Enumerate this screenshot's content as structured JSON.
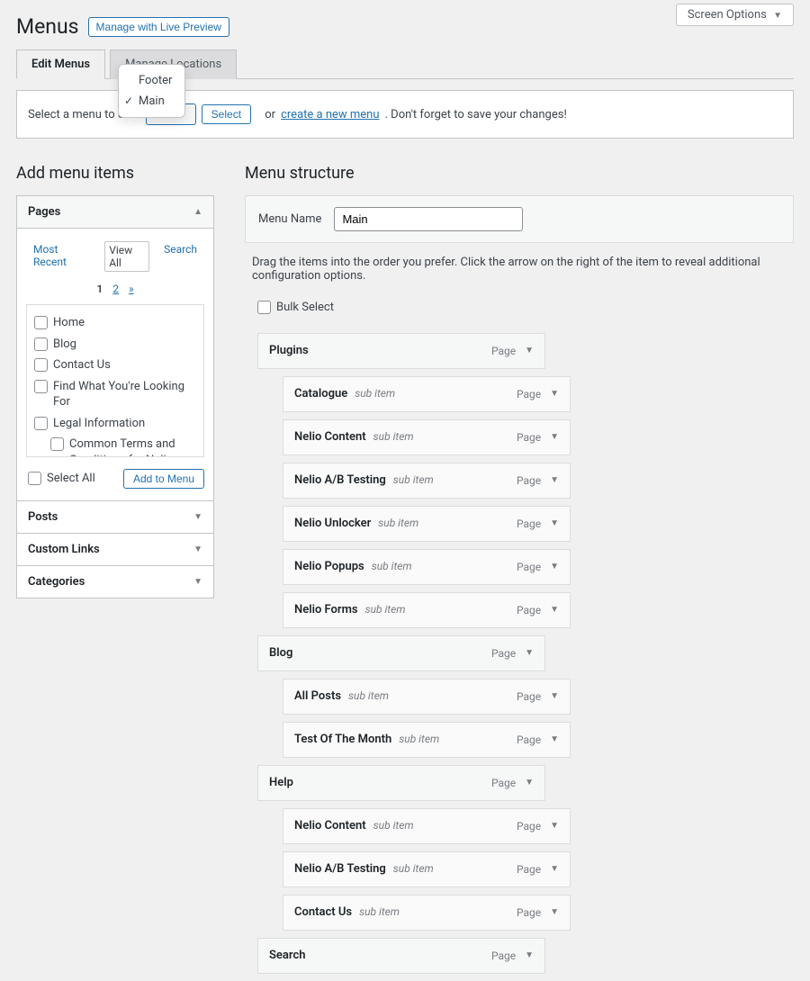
{
  "screen_options": "Screen Options",
  "page_title": "Menus",
  "live_preview": "Manage with Live Preview",
  "tabs": {
    "edit": "Edit Menus",
    "locations": "Manage Locations"
  },
  "select_menu_label": "Select a menu to edit:",
  "select_btn": "Select",
  "or_text": "or",
  "create_menu_link": "create a new menu",
  "save_reminder": ". Don't forget to save your changes!",
  "dropdown": {
    "footer": "Footer",
    "main": "Main"
  },
  "add_items_heading": "Add menu items",
  "menu_structure_heading": "Menu structure",
  "pages_box": {
    "title": "Pages",
    "subtabs": {
      "recent": "Most Recent",
      "all": "View All",
      "search": "Search"
    },
    "pager": {
      "p1": "1",
      "p2": "2",
      "next": "»"
    },
    "items": {
      "home": "Home",
      "blog": "Blog",
      "contact": "Contact Us",
      "find": "Find What You're Looking For",
      "legal": "Legal Information",
      "terms": "Common Terms and Conditions for Nelio Services"
    },
    "select_all": "Select All",
    "add_to_menu": "Add to Menu"
  },
  "posts_box": "Posts",
  "links_box": "Custom Links",
  "cats_box": "Categories",
  "menu_name_label": "Menu Name",
  "menu_name_value": "Main",
  "drag_note": "Drag the items into the order you prefer. Click the arrow on the right of the item to reveal additional configuration options.",
  "bulk_select": "Bulk Select",
  "type_label": "Page",
  "sub_item_label": "sub item",
  "items": {
    "plugins": "Plugins",
    "catalogue": "Catalogue",
    "ncontent": "Nelio Content",
    "nab": "Nelio A/B Testing",
    "nunlock": "Nelio Unlocker",
    "npopups": "Nelio Popups",
    "nforms": "Nelio Forms",
    "blog": "Blog",
    "allposts": "All Posts",
    "totm": "Test Of The Month",
    "help": "Help",
    "hcontent": "Nelio Content",
    "hnab": "Nelio A/B Testing",
    "hcontact": "Contact Us",
    "search": "Search"
  }
}
